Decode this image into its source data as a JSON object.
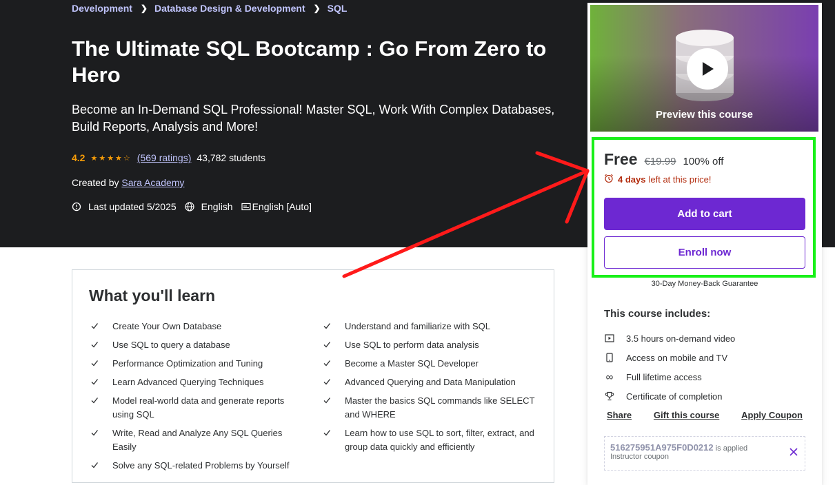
{
  "breadcrumb": [
    "Development",
    "Database Design & Development",
    "SQL"
  ],
  "course": {
    "title": "The Ultimate SQL Bootcamp : Go From Zero to Hero",
    "subtitle": "Become an In-Demand SQL Professional! Master SQL, Work With Complex Databases, Build Reports, Analysis and More!",
    "rating": "4.2",
    "rating_link": "(569 ratings)",
    "students": "43,782 students",
    "created_by_label": "Created by",
    "instructor": "Sara Academy",
    "last_updated": "Last updated 5/2025",
    "language": "English",
    "captions": "English [Auto]"
  },
  "sidebar": {
    "preview_label": "Preview this course",
    "price": "Free",
    "original_price": "€19.99",
    "discount": "100% off",
    "timer_bold": "4 days",
    "timer_rest": "left at this price!",
    "add_to_cart": "Add to cart",
    "enroll_now": "Enroll now",
    "guarantee": "30-Day Money-Back Guarantee",
    "includes_title": "This course includes:",
    "includes": [
      {
        "icon": "video-icon",
        "label": "3.5 hours on-demand video"
      },
      {
        "icon": "mobile-icon",
        "label": "Access on mobile and TV"
      },
      {
        "icon": "infinity-icon",
        "label": "Full lifetime access"
      },
      {
        "icon": "trophy-icon",
        "label": "Certificate of completion"
      }
    ],
    "links": [
      "Share",
      "Gift this course",
      "Apply Coupon"
    ],
    "coupon_code": "516275951A975F0D0212",
    "coupon_applied": "is applied",
    "coupon_type": "Instructor coupon"
  },
  "learn": {
    "title": "What you'll learn",
    "left": [
      "Create Your Own Database",
      "Use SQL to query a database",
      "Performance Optimization and Tuning",
      "Learn Advanced Querying Techniques",
      "Model real-world data and generate reports using SQL",
      "Write, Read and Analyze Any SQL Queries Easily",
      "Solve any SQL-related Problems by Yourself"
    ],
    "right": [
      "Understand and familiarize with SQL",
      "Use SQL to perform data analysis",
      "Become a Master SQL Developer",
      "Advanced Querying and Data Manipulation",
      "Master the basics SQL commands like SELECT and WHERE",
      "Learn how to use SQL to sort, filter, extract, and group data quickly and efficiently"
    ]
  },
  "colors": {
    "accent": "#6d28d2",
    "hero_bg": "#1c1d1f",
    "link": "#c0c4fc",
    "star": "#f69c08",
    "highlight": "#19f019",
    "arrow": "#ff1a1a"
  }
}
